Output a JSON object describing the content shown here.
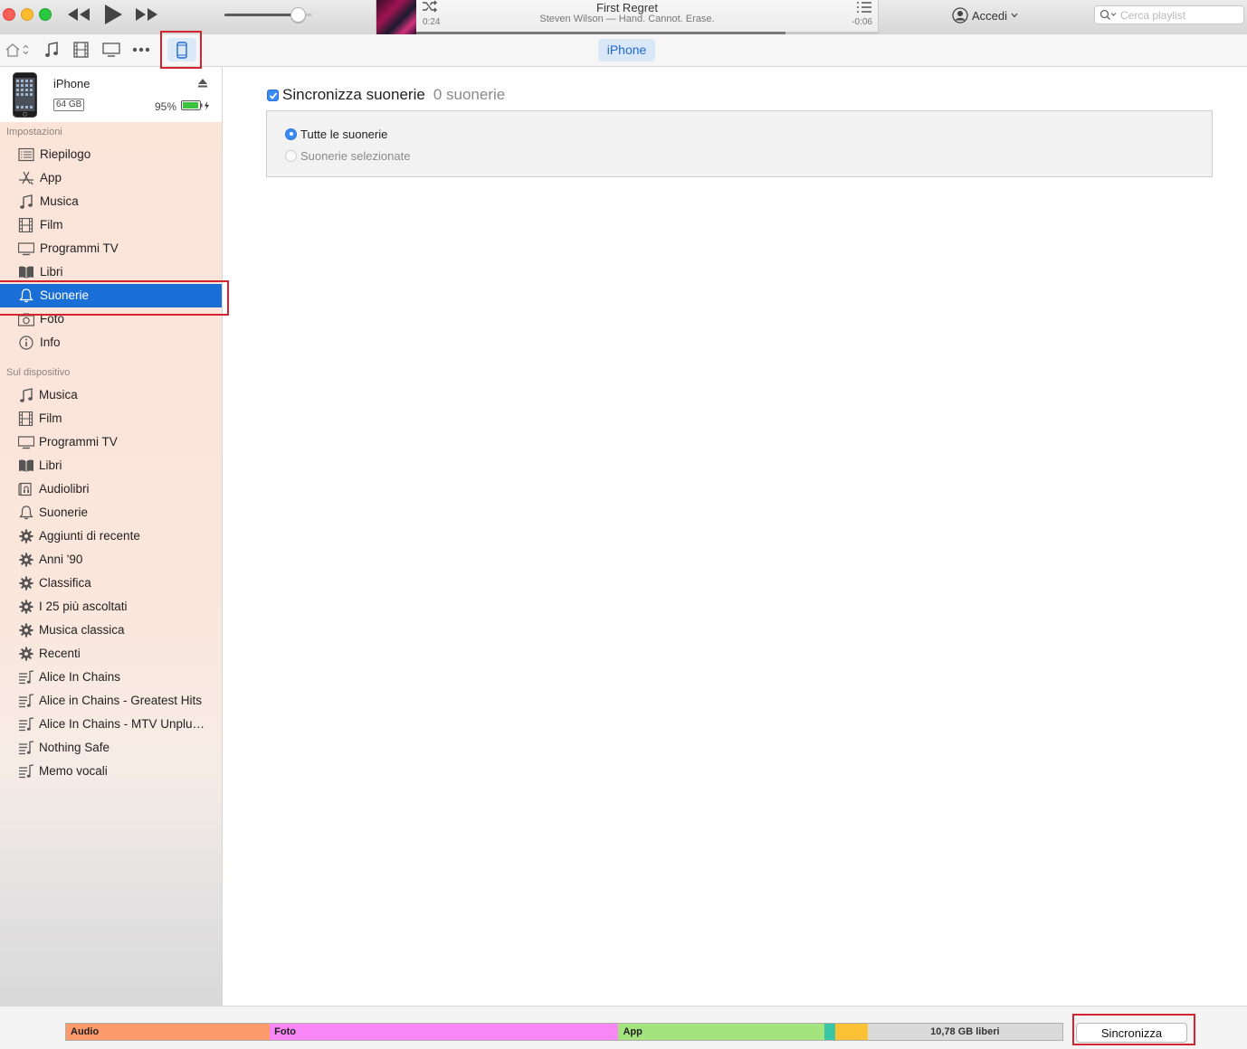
{
  "player": {
    "song_title": "First Regret",
    "song_subtitle": "Steven Wilson — Hand. Cannot. Erase.",
    "time_elapsed": "0:24",
    "time_remaining": "-0:06",
    "progress": 0.8,
    "volume": 0.8
  },
  "account": {
    "label": "Accedi"
  },
  "search": {
    "placeholder": "Cerca playlist"
  },
  "toolbar": {
    "icons": [
      "home-icon",
      "music-note-icon",
      "film-icon",
      "tv-icon",
      "more-icon",
      "iphone-icon"
    ],
    "device_tab": "iPhone"
  },
  "device": {
    "name": "iPhone",
    "capacity": "64 GB",
    "battery": "95%",
    "battery_level": 0.95
  },
  "sidebar": {
    "settings_title": "Impostazioni",
    "settings": [
      {
        "label": "Riepilogo",
        "icon": "summary-icon"
      },
      {
        "label": "App",
        "icon": "app-store-icon"
      },
      {
        "label": "Musica",
        "icon": "music-note-icon"
      },
      {
        "label": "Film",
        "icon": "film-icon"
      },
      {
        "label": "Programmi TV",
        "icon": "tv-icon"
      },
      {
        "label": "Libri",
        "icon": "book-icon"
      },
      {
        "label": "Suonerie",
        "icon": "bell-icon",
        "selected": true
      },
      {
        "label": "Foto",
        "icon": "camera-icon"
      },
      {
        "label": "Info",
        "icon": "info-icon"
      }
    ],
    "device_title": "Sul dispositivo",
    "on_device": [
      {
        "label": "Musica",
        "icon": "music-note-icon"
      },
      {
        "label": "Film",
        "icon": "film-icon"
      },
      {
        "label": "Programmi TV",
        "icon": "tv-icon"
      },
      {
        "label": "Libri",
        "icon": "book-icon"
      },
      {
        "label": "Audiolibri",
        "icon": "audiobook-icon"
      },
      {
        "label": "Suonerie",
        "icon": "bell-icon"
      },
      {
        "label": "Aggiunti di recente",
        "icon": "gear-icon"
      },
      {
        "label": "Anni '90",
        "icon": "gear-icon"
      },
      {
        "label": "Classifica",
        "icon": "gear-icon"
      },
      {
        "label": "I 25 più ascoltati",
        "icon": "gear-icon"
      },
      {
        "label": "Musica classica",
        "icon": "gear-icon"
      },
      {
        "label": "Recenti",
        "icon": "gear-icon"
      },
      {
        "label": "Alice In Chains",
        "icon": "playlist-icon"
      },
      {
        "label": "Alice in Chains - Greatest Hits",
        "icon": "playlist-icon"
      },
      {
        "label": "Alice In Chains - MTV Unplu…",
        "icon": "playlist-icon"
      },
      {
        "label": "Nothing Safe",
        "icon": "playlist-icon"
      },
      {
        "label": "Memo vocali",
        "icon": "playlist-icon"
      }
    ]
  },
  "main": {
    "sync_label": "Sincronizza suonerie",
    "sync_count": "0 suonerie",
    "sync_checked": true,
    "options": [
      {
        "label": "Tutte le suonerie",
        "selected": true
      },
      {
        "label": "Suonerie selezionate",
        "selected": false
      }
    ]
  },
  "storage": {
    "segments": [
      {
        "label": "Audio",
        "fraction": 0.2045,
        "color": "#fc9a6c"
      },
      {
        "label": "Foto",
        "fraction": 0.35,
        "color": "#f986f5"
      },
      {
        "label": "App",
        "fraction": 0.2065,
        "color": "#a4e47e"
      },
      {
        "label": "",
        "fraction": 0.011,
        "color": "#3cc6a8"
      },
      {
        "label": "",
        "fraction": 0.0325,
        "color": "#fcc236"
      }
    ],
    "free_label": "10,78 GB liberi",
    "free_color": "#dadada"
  },
  "sync_button": "Sincronizza",
  "colors": {
    "accent": "#1a6fd7",
    "highlight": "#d42430"
  }
}
